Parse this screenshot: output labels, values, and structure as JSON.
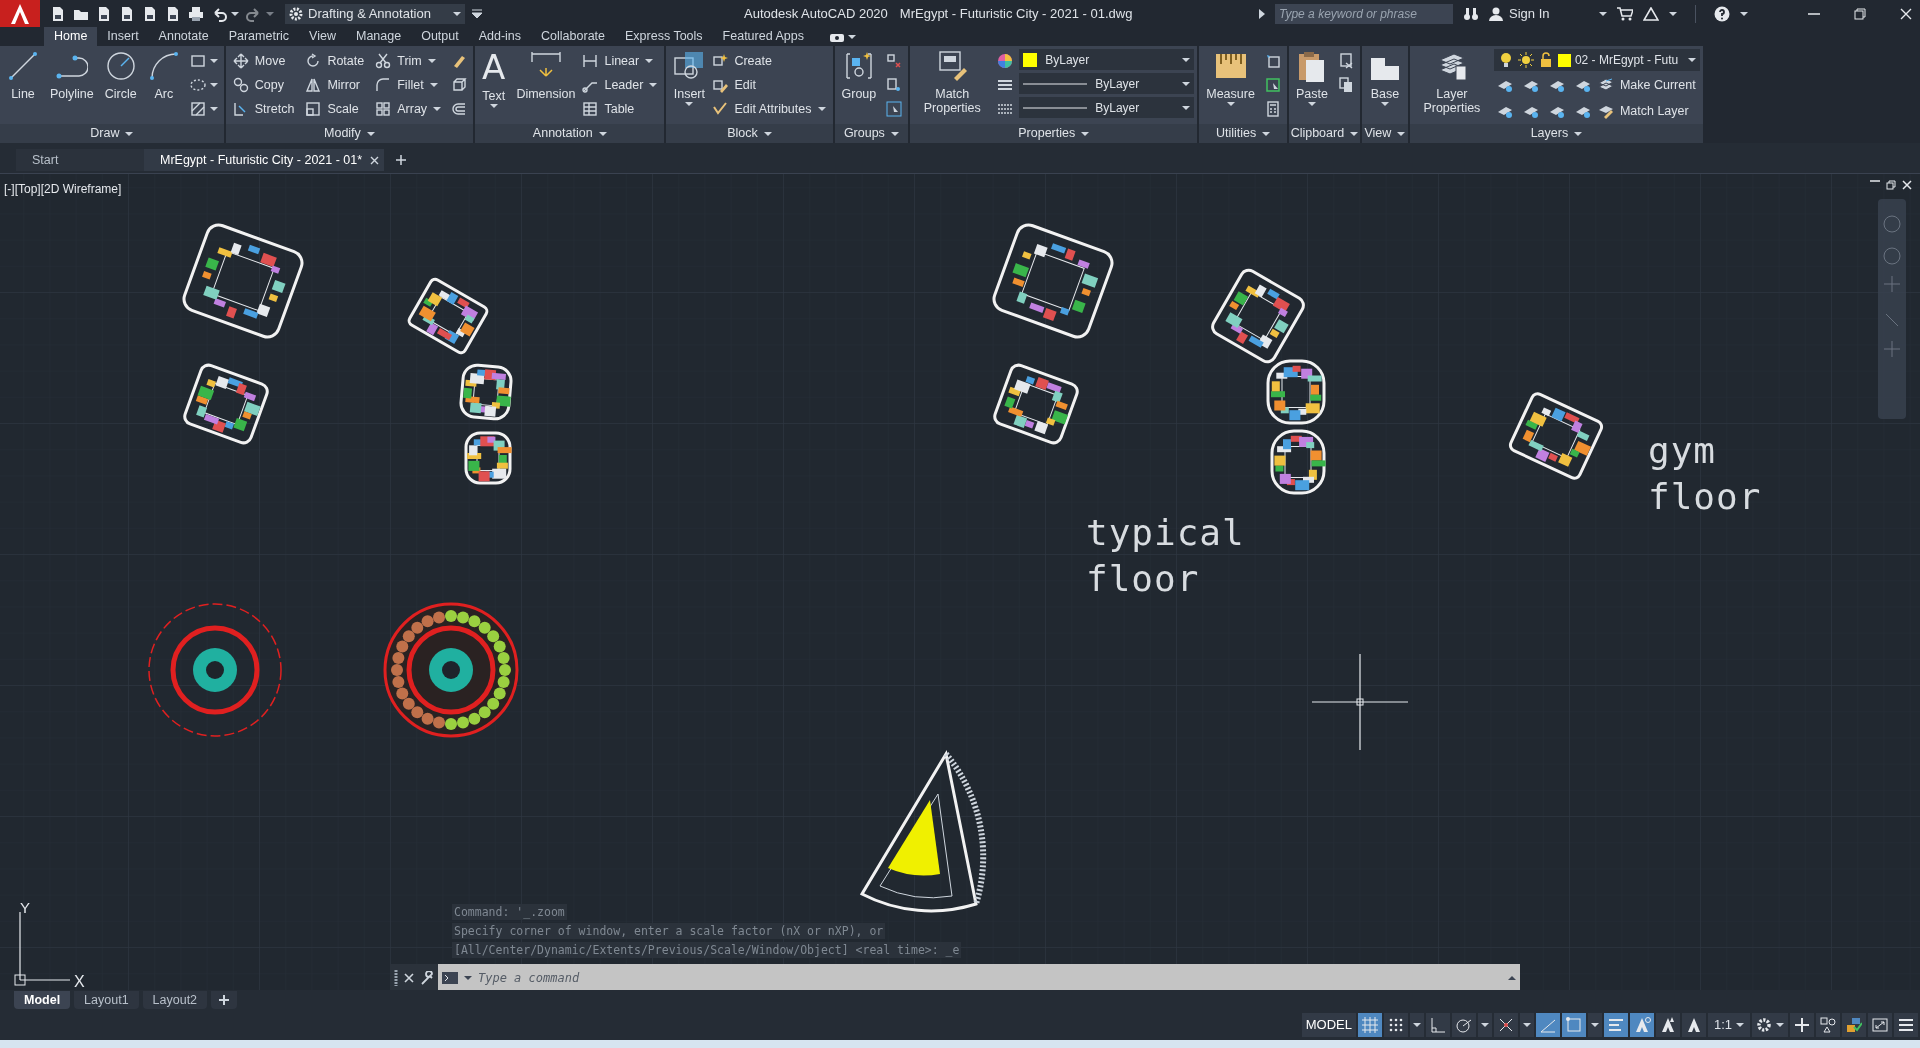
{
  "app_name": "Autodesk AutoCAD 2020",
  "document_title": "MrEgypt - Futuristic City - 2021 - 01.dwg",
  "workspace": "Drafting & Annotation",
  "search": {
    "placeholder": "Type a keyword or phrase"
  },
  "sign_in": "Sign In",
  "ribbon_tabs": [
    {
      "label": "Home",
      "selected": true
    },
    {
      "label": "Insert",
      "selected": false
    },
    {
      "label": "Annotate",
      "selected": false
    },
    {
      "label": "Parametric",
      "selected": false
    },
    {
      "label": "View",
      "selected": false
    },
    {
      "label": "Manage",
      "selected": false
    },
    {
      "label": "Output",
      "selected": false
    },
    {
      "label": "Add-ins",
      "selected": false
    },
    {
      "label": "Collaborate",
      "selected": false
    },
    {
      "label": "Express Tools",
      "selected": false
    },
    {
      "label": "Featured Apps",
      "selected": false
    }
  ],
  "ribbon_panels": [
    {
      "kind": "draw",
      "title": "Draw",
      "big": [
        "Line",
        "Polyline",
        "Circle",
        "Arc"
      ]
    },
    {
      "kind": "modify",
      "title": "Modify",
      "small": [
        "Move",
        "Copy",
        "Stretch",
        "Rotate",
        "Mirror",
        "Scale",
        "Trim",
        "Fillet",
        "Array"
      ]
    },
    {
      "kind": "annotation",
      "title": "Annotation",
      "glyph": "A",
      "big": [
        "Text",
        "Dimension"
      ],
      "small": [
        "Linear",
        "Leader",
        "Table"
      ]
    },
    {
      "kind": "block",
      "title": "Block",
      "big": [
        "Insert"
      ],
      "small": [
        "Create",
        "Edit",
        "Edit Attributes"
      ]
    },
    {
      "kind": "groups",
      "title": "Groups",
      "big": [
        "Group"
      ]
    },
    {
      "kind": "properties",
      "title": "Properties",
      "big": [
        "Match Properties"
      ],
      "dropdowns": [
        {
          "value": "ByLayer",
          "color": "#ffff00"
        },
        {
          "value": "ByLayer"
        },
        {
          "value": "ByLayer"
        }
      ]
    },
    {
      "kind": "utilities",
      "title": "Utilities",
      "big": [
        "Measure"
      ]
    },
    {
      "kind": "clipboard",
      "title": "Clipboard",
      "big": [
        "Paste"
      ]
    },
    {
      "kind": "view",
      "title": "View",
      "big": [
        "Base"
      ]
    },
    {
      "kind": "layers",
      "title": "Layers",
      "big": [
        "Layer Properties"
      ],
      "layer": {
        "value": "02 - MrEgypt - Futu",
        "color": "#ffff00"
      },
      "small": [
        "Make Current",
        "Match Layer"
      ]
    }
  ],
  "file_tabs": [
    {
      "label": "Start",
      "selected": false
    },
    {
      "label": "MrEgypt - Futuristic City - 2021 - 01*",
      "selected": true
    }
  ],
  "viewport_label": "[-][Top][2D Wireframe]",
  "canvas_texts": [
    {
      "text": "typical floor"
    },
    {
      "text": "gym floor"
    }
  ],
  "axis_labels": {
    "x": "X",
    "y": "Y"
  },
  "command_history": [
    "Command: '_.zoom",
    "Specify corner of window, enter a scale factor (nX or nXP), or",
    "[All/Center/Dynamic/Extents/Previous/Scale/Window/Object] <real time>: _e"
  ],
  "command_input": {
    "placeholder": "Type a command"
  },
  "layout_tabs": [
    {
      "label": "Model",
      "selected": true
    },
    {
      "label": "Layout1",
      "selected": false
    },
    {
      "label": "Layout2",
      "selected": false
    }
  ],
  "status_bar": {
    "space": "MODEL",
    "scale": "1:1",
    "toggles": [
      {
        "on": true
      },
      {
        "on": false
      },
      {
        "on": false
      },
      {
        "on": false
      },
      {
        "on": false
      },
      {
        "on": true
      },
      {
        "on": true
      },
      {
        "on": true
      },
      {
        "on": true
      },
      {
        "on": false
      },
      {
        "on": false
      }
    ]
  }
}
